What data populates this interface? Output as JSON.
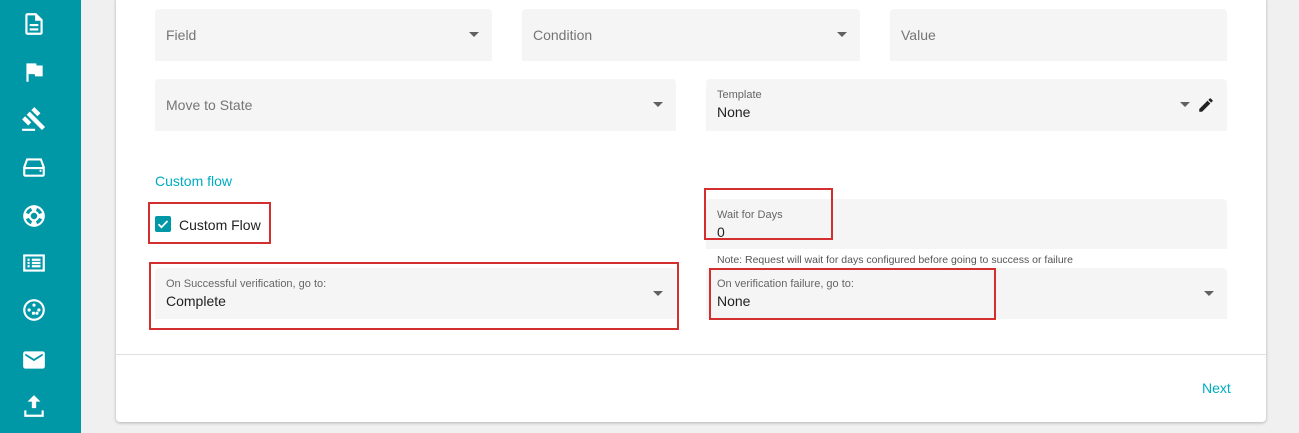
{
  "sidebar": {
    "icons": [
      "document-icon",
      "flag-icon",
      "gavel-icon",
      "inbox-icon",
      "lifebuoy-icon",
      "list-icon",
      "settings-wheel-icon",
      "mail-icon",
      "upload-icon"
    ]
  },
  "filters": {
    "field_placeholder": "Field",
    "condition_placeholder": "Condition",
    "value_placeholder": "Value"
  },
  "move_to_state": {
    "placeholder": "Move to State"
  },
  "template": {
    "label": "Template",
    "value": "None"
  },
  "custom_flow": {
    "section_title": "Custom flow",
    "checkbox_label": "Custom Flow",
    "checked": true
  },
  "wait_days": {
    "label": "Wait for Days",
    "value": "0",
    "note": "Note: Request will wait for days configured before going to success or failure"
  },
  "on_success": {
    "label": "On Successful verification, go to:",
    "value": "Complete"
  },
  "on_failure": {
    "label": "On verification failure, go to:",
    "value": "None"
  },
  "footer": {
    "next_label": "Next"
  },
  "colors": {
    "sidebar": "#0097a7",
    "accent": "#00acc1",
    "highlight": "#d32f2f"
  }
}
